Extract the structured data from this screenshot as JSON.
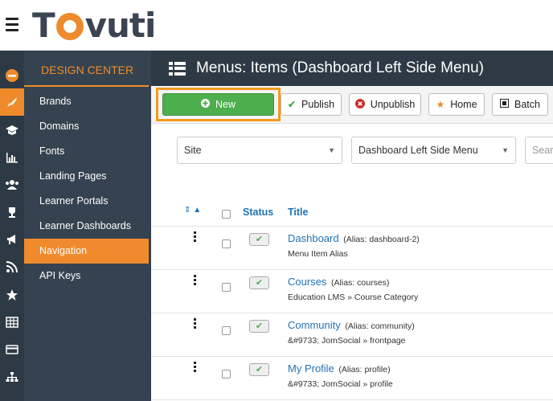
{
  "brand": {
    "logo_text_pre": "T",
    "logo_text_post": "vuti"
  },
  "sidebar": {
    "heading": "DESIGN CENTER",
    "items": [
      {
        "label": "Brands"
      },
      {
        "label": "Domains"
      },
      {
        "label": "Fonts"
      },
      {
        "label": "Landing Pages"
      },
      {
        "label": "Learner Portals"
      },
      {
        "label": "Learner Dashboards"
      },
      {
        "label": "Navigation",
        "active": true
      },
      {
        "label": "API Keys"
      }
    ]
  },
  "page": {
    "title": "Menus: Items (Dashboard Left Side Menu)"
  },
  "toolbar": {
    "new_label": "New",
    "publish_label": "Publish",
    "unpublish_label": "Unpublish",
    "home_label": "Home",
    "batch_label": "Batch"
  },
  "filters": {
    "site": "Site",
    "menu": "Dashboard Left Side Menu",
    "search_placeholder": "Search"
  },
  "table": {
    "col_status": "Status",
    "col_title": "Title",
    "rows": [
      {
        "title": "Dashboard",
        "alias": "(Alias: dashboard-2)",
        "sub": "Menu Item Alias"
      },
      {
        "title": "Courses",
        "alias": "(Alias: courses)",
        "sub": "Education LMS » Course Category"
      },
      {
        "title": "Community",
        "alias": "(Alias: community)",
        "sub": "&#9733; JomSocial » frontpage"
      },
      {
        "title": "My Profile",
        "alias": "(Alias: profile)",
        "sub": "&#9733; JomSocial » profile"
      }
    ]
  },
  "colors": {
    "accent": "#ef8b2c",
    "sidebar": "#34434f",
    "iconbar": "#2d3a45",
    "link": "#1f73b6",
    "success": "#4cae4c"
  }
}
